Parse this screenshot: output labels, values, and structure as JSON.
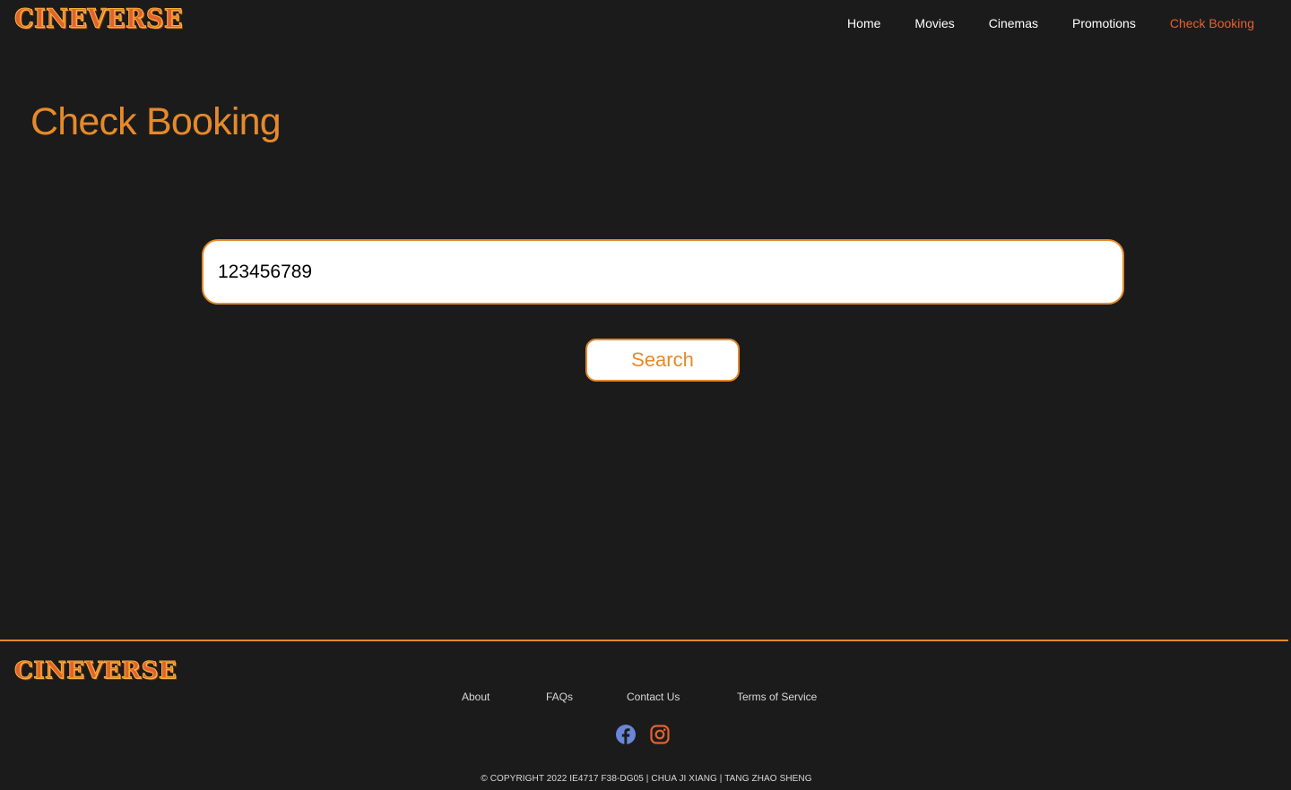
{
  "brand": {
    "logo_text": "CINEVERSE"
  },
  "nav": {
    "items": [
      {
        "label": "Home"
      },
      {
        "label": "Movies"
      },
      {
        "label": "Cinemas"
      },
      {
        "label": "Promotions"
      },
      {
        "label": "Check Booking",
        "active": true
      }
    ]
  },
  "main": {
    "title": "Check Booking",
    "search_value": "123456789",
    "search_button_label": "Search"
  },
  "footer": {
    "logo_text": "CINEVERSE",
    "links": [
      "About",
      "FAQs",
      "Contact Us",
      "Terms of Service"
    ],
    "social_icons": [
      "facebook-icon",
      "instagram-icon"
    ],
    "copyright": "© COPYRIGHT 2022 IE4717 F38-DG05 | CHUA JI XIANG | TANG ZHAO SHENG"
  },
  "colors": {
    "background": "#1b1b1b",
    "accent": "#e58a2a",
    "active_nav": "#e4622e",
    "facebook": "#6a86d8",
    "instagram": "#e4622e"
  }
}
